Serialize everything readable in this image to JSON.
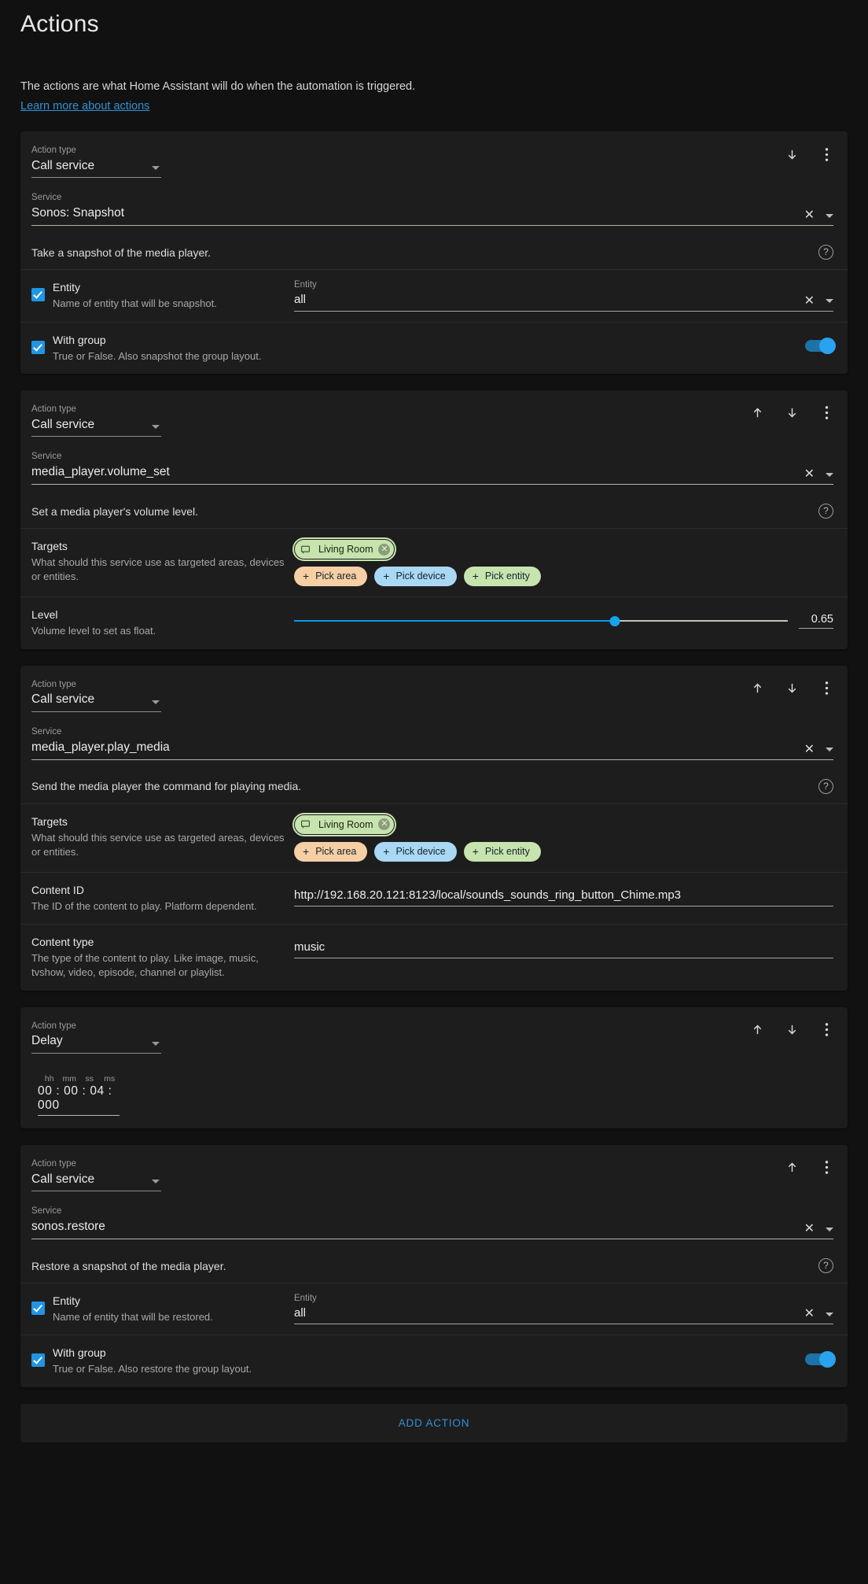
{
  "header": {
    "title": "Actions",
    "description": "The actions are what Home Assistant will do when the automation is triggered.",
    "learn_more": "Learn more about actions"
  },
  "labels": {
    "action_type": "Action type",
    "service": "Service",
    "entity": "Entity",
    "targets": "Targets",
    "pick_area": "Pick area",
    "pick_device": "Pick device",
    "pick_entity": "Pick entity",
    "help": "?",
    "clear": "✕"
  },
  "duration_heads": {
    "hh": "hh",
    "mm": "mm",
    "ss": "ss",
    "ms": "ms"
  },
  "actions": [
    {
      "action_type": "Call service",
      "service": "Sonos: Snapshot",
      "description": "Take a snapshot of the media player.",
      "entity_label": "Entity",
      "entity_title": "Entity",
      "entity_sub": "Name of entity that will be snapshot.",
      "entity_value": "all",
      "group_title": "With group",
      "group_sub": "True or False. Also snapshot the group layout."
    },
    {
      "action_type": "Call service",
      "service": "media_player.volume_set",
      "description": "Set a media player's volume level.",
      "targets_title": "Targets",
      "targets_sub": "What should this service use as targeted areas, devices or entities.",
      "target_chip": "Living Room",
      "level_title": "Level",
      "level_sub": "Volume level to set as float.",
      "level_value": "0.65",
      "level_percent": 65
    },
    {
      "action_type": "Call service",
      "service": "media_player.play_media",
      "description": "Send the media player the command for playing media.",
      "targets_title": "Targets",
      "targets_sub": "What should this service use as targeted areas, devices or entities.",
      "target_chip": "Living Room",
      "content_id_title": "Content ID",
      "content_id_sub": "The ID of the content to play. Platform dependent.",
      "content_id_value": "http://192.168.20.121:8123/local/sounds_sounds_ring_button_Chime.mp3",
      "content_type_title": "Content type",
      "content_type_sub": "The type of the content to play. Like image, music, tvshow, video, episode, channel or playlist.",
      "content_type_value": "music"
    },
    {
      "action_type": "Delay",
      "duration": "00 : 00 : 04 : 000"
    },
    {
      "action_type": "Call service",
      "service": "sonos.restore",
      "description": "Restore a snapshot of the media player.",
      "entity_label": "Entity",
      "entity_title": "Entity",
      "entity_sub": "Name of entity that will be restored.",
      "entity_value": "all",
      "group_title": "With group",
      "group_sub": "True or False. Also restore the group layout."
    }
  ],
  "footer": {
    "add_action": "ADD ACTION"
  },
  "colors": {
    "accent": "#3391d6",
    "toggle_on": "#29a3ef",
    "checkbox": "#2095e4",
    "chip_area": "#f6cfa4",
    "chip_device": "#a9d8f4",
    "chip_entity": "#c7e3ae",
    "slider": "#16a2ec"
  }
}
